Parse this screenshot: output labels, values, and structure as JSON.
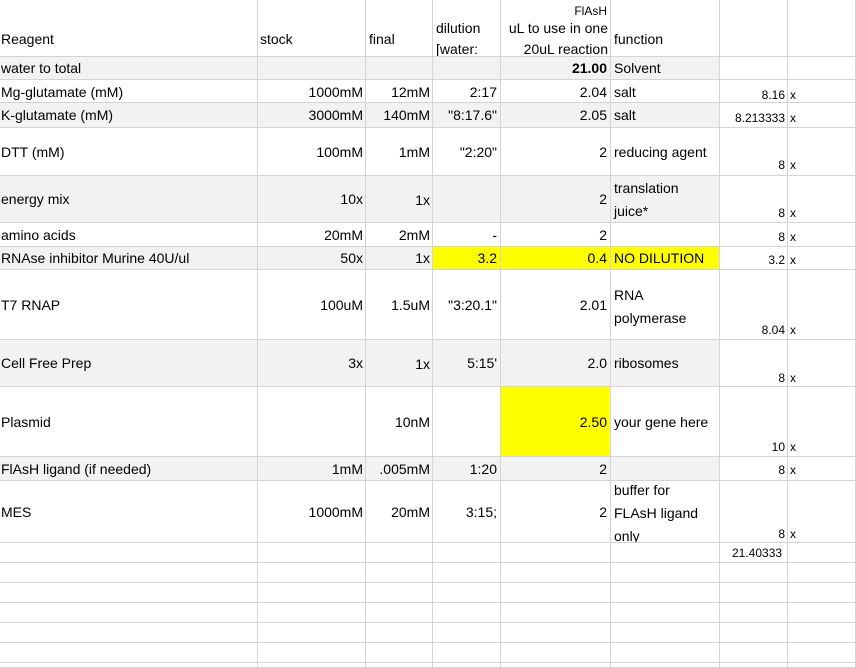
{
  "sheet": {
    "header": {
      "reagent": "Reagent",
      "stock": "stock",
      "final": "final",
      "dilution_line1": "dilution",
      "dilution_line2": "[water:",
      "flash": "FlAsH",
      "ul_line1": "uL to use in one",
      "ul_line2": "20uL reaction",
      "function": "function"
    },
    "rows": [
      {
        "reagent": "water to total",
        "stock": "",
        "final": "",
        "dilution": "",
        "ul": "21.00",
        "fn1": "Solvent",
        "fn2": "",
        "fn3": "",
        "extra": "",
        "x": ""
      },
      {
        "reagent": "Mg-glutamate (mM)",
        "stock": "1000mM",
        "final": "12mM",
        "dilution": "2:17",
        "ul": "2.04",
        "fn1": "salt",
        "fn2": "",
        "fn3": "",
        "extra": "8.16",
        "x": "x"
      },
      {
        "reagent": "K-glutamate (mM)",
        "stock": "3000mM",
        "final": "140mM",
        "dilution": "\"8:17.6\"",
        "ul": "2.05",
        "fn1": "salt",
        "fn2": "",
        "fn3": "",
        "extra": "8.213333",
        "x": "x"
      },
      {
        "reagent": "DTT (mM)",
        "stock": "100mM",
        "final": "1mM",
        "dilution": "\"2:20\"",
        "ul": "2",
        "fn1": "reducing agent",
        "fn2": "",
        "fn3": "",
        "extra": "8",
        "x": "x"
      },
      {
        "reagent": "energy mix",
        "stock": "10x",
        "final": "1x",
        "dilution": "",
        "ul": "2",
        "fn1": "translation",
        "fn2": "juice*",
        "fn3": "",
        "extra": "8",
        "x": "x"
      },
      {
        "reagent": "amino acids",
        "stock": "20mM",
        "final": "2mM",
        "dilution": "-",
        "ul": "2",
        "fn1": "",
        "fn2": "",
        "fn3": "",
        "extra": "8",
        "x": "x"
      },
      {
        "reagent": "RNAse inhibitor  Murine 40U/ul",
        "stock": "50x",
        "final": "1x",
        "dilution": "3.2",
        "ul": "0.4",
        "fn1": "NO DILUTION",
        "fn2": "",
        "fn3": "",
        "extra": "3.2",
        "x": "x"
      },
      {
        "reagent": "T7 RNAP",
        "stock": "100uM",
        "final": "1.5uM",
        "dilution": "\"3:20.1\"",
        "ul": "2.01",
        "fn1": "RNA",
        "fn2": "polymerase",
        "fn3": "",
        "extra": "8.04",
        "x": "x"
      },
      {
        "reagent": "Cell Free Prep",
        "stock": "3x",
        "final": "1x",
        "dilution": "5:15'",
        "ul": "2.0",
        "fn1": "ribosomes",
        "fn2": "",
        "fn3": "",
        "extra": "8",
        "x": "x"
      },
      {
        "reagent": "Plasmid",
        "stock": "",
        "final": "10nM",
        "dilution": "",
        "ul": "2.50",
        "fn1": "your gene here",
        "fn2": "",
        "fn3": "",
        "extra": "10",
        "x": "x"
      },
      {
        "reagent": "FlAsH ligand (if needed)",
        "stock": "1mM",
        "final": ".005mM",
        "dilution": "1:20",
        "ul": "2",
        "fn1": "",
        "fn2": "",
        "fn3": "",
        "extra": "8",
        "x": "x"
      },
      {
        "reagent": "MES",
        "stock": "1000mM",
        "final": "20mM",
        "dilution": "3:15;",
        "ul": "2",
        "fn1": "buffer for",
        "fn2": "FLAsH ligand",
        "fn3": "only",
        "extra": "8",
        "x": "x"
      }
    ],
    "total": "21.40333"
  },
  "colors": {
    "highlight": "#ffff00",
    "shaded_row": "#f2f2f2",
    "grid_line": "#d4d4d4"
  }
}
